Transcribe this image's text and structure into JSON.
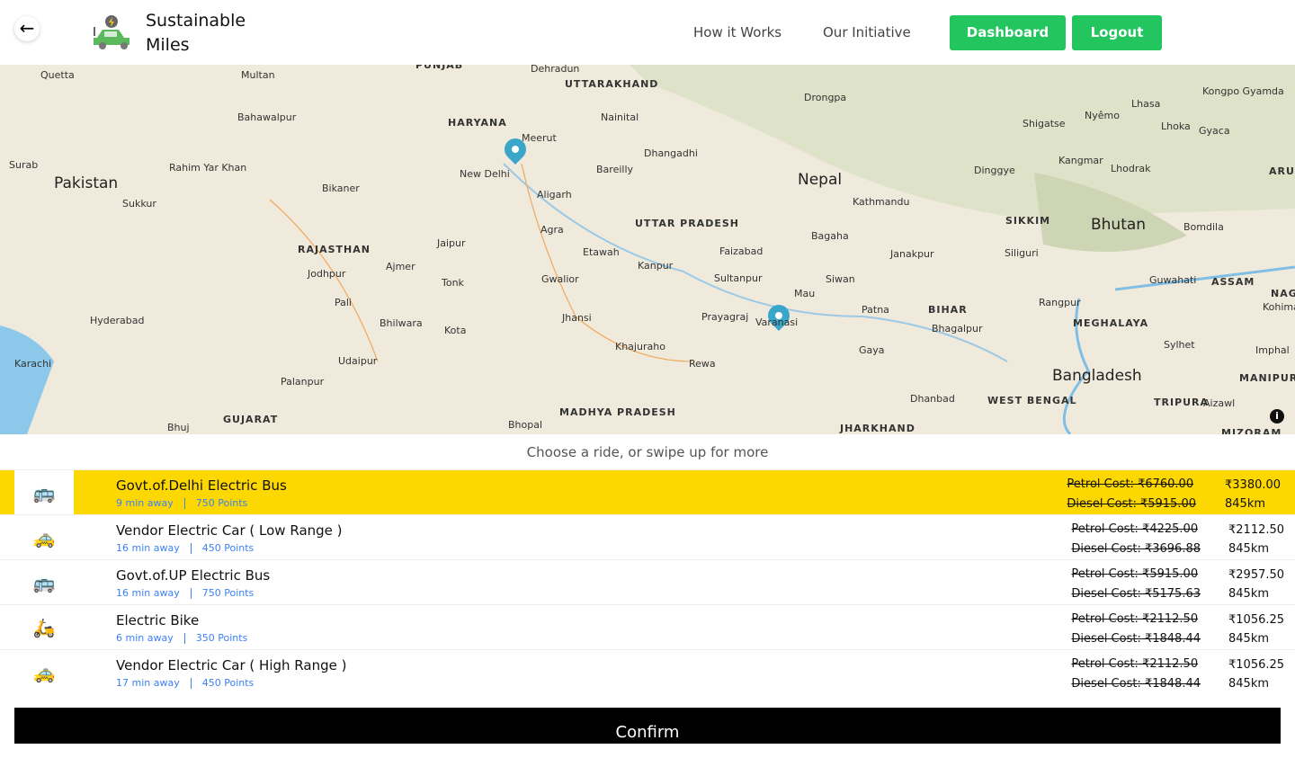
{
  "header": {
    "brand_line1": "Sustainable",
    "brand_line2": "Miles",
    "nav": [
      "How it Works",
      "Our Initiative"
    ],
    "dashboard": "Dashboard",
    "logout": "Logout"
  },
  "map": {
    "labels": [
      "Quetta",
      "Multan",
      "Bahawalpur",
      "Surab",
      "Pakistan",
      "Rahim Yar Khan",
      "Sukkur",
      "Hyderabad",
      "Karachi",
      "PUNJAB",
      "HARYANA",
      "Dehradun",
      "UTTARAKHAND",
      "Nainital",
      "Meerut",
      "New Delhi",
      "Bikaner",
      "RAJASTHAN",
      "Jodhpur",
      "Ajmer",
      "Jaipur",
      "Pali",
      "Bhilwara",
      "Udaipur",
      "Palanpur",
      "GUJARAT",
      "Bhuj",
      "Aligarh",
      "Agra",
      "Bareilly",
      "Dhangadhi",
      "Etawah",
      "Tonk",
      "Gwalior",
      "Kota",
      "Jhansi",
      "Bhopal",
      "MADHYA PRADESH",
      "UTTAR PRADESH",
      "Kanpur",
      "Faizabad",
      "Sultanpur",
      "Prayagraj",
      "Varanasi",
      "Khajuraho",
      "Rewa",
      "Drongpa",
      "Nepal",
      "Kathmandu",
      "Bagaha",
      "Siwan",
      "Mau",
      "Janakpur",
      "Patna",
      "BIHAR",
      "Bhagalpur",
      "Gaya",
      "Dhanbad",
      "JHARKHAND",
      "WEST BENGAL",
      "Lhasa",
      "Nyêmo",
      "Shigatse",
      "Lhoka",
      "Gyaca",
      "Kongpo Gyamda",
      "Dinggye",
      "Kangmar",
      "Lhodrak",
      "SIKKIM",
      "Bhutan",
      "Siliguri",
      "Bomdila",
      "Guwahati",
      "ASSAM",
      "Rangpur",
      "MEGHALAYA",
      "Sylhet",
      "Bangladesh",
      "TRIPURA",
      "Aizawl",
      "Imphal",
      "MANIPUR",
      "MIZORAM",
      "NAGA",
      "Kohima",
      "ARU"
    ]
  },
  "hint": "Choose a ride, or swipe up for more",
  "rides": [
    {
      "icon": "electric-bus-icon",
      "name": "Govt.of.Delhi Electric Bus",
      "eta": "9 min away",
      "points": "750 Points",
      "petrol": "Petrol Cost: ₹6760.00",
      "diesel": "Diesel Cost: ₹5915.00",
      "price": "₹3380.00",
      "distance": "845km",
      "selected": true
    },
    {
      "icon": "electric-car-icon",
      "name": "Vendor Electric Car ( Low Range )",
      "eta": "16 min away",
      "points": "450 Points",
      "petrol": "Petrol Cost: ₹4225.00",
      "diesel": "Diesel Cost: ₹3696.88",
      "price": "₹2112.50",
      "distance": "845km"
    },
    {
      "icon": "electric-bus-icon",
      "name": "Govt.of.UP Electric Bus",
      "eta": "16 min away",
      "points": "750 Points",
      "petrol": "Petrol Cost: ₹5915.00",
      "diesel": "Diesel Cost: ₹5175.63",
      "price": "₹2957.50",
      "distance": "845km"
    },
    {
      "icon": "electric-bike-icon",
      "name": "Electric Bike",
      "eta": "6 min away",
      "points": "350 Points",
      "petrol": "Petrol Cost: ₹2112.50",
      "diesel": "Diesel Cost: ₹1848.44",
      "price": "₹1056.25",
      "distance": "845km"
    },
    {
      "icon": "electric-car-icon",
      "name": "Vendor Electric Car ( High Range )",
      "eta": "17 min away",
      "points": "450 Points",
      "petrol": "Petrol Cost: ₹2112.50",
      "diesel": "Diesel Cost: ₹1848.44",
      "price": "₹1056.25",
      "distance": "845km"
    }
  ],
  "confirm": "Confirm",
  "colors": {
    "accent": "#22c55e",
    "selected": "#fdd700",
    "meta": "#3b82f6",
    "marker": "#3aa6c9"
  }
}
